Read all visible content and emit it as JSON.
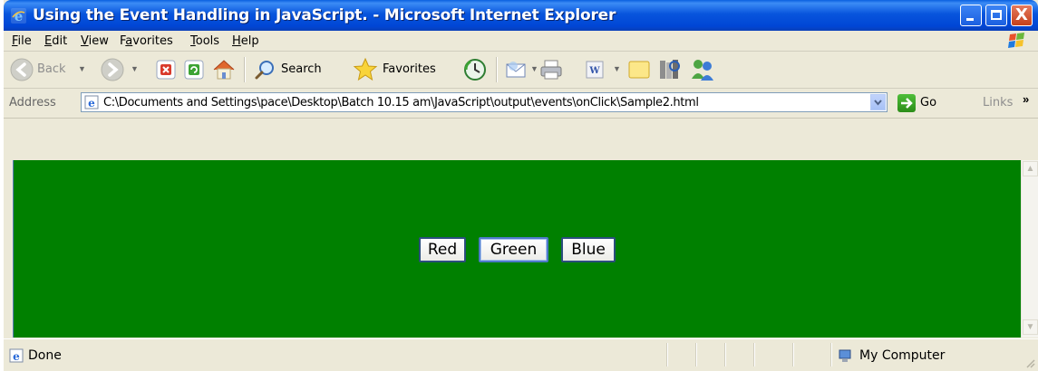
{
  "window": {
    "title": "Using the Event Handling in JavaScript. - Microsoft Internet Explorer",
    "controls": {
      "minimize": "minimize",
      "maximize": "maximize",
      "close": "X"
    }
  },
  "menu": {
    "items": [
      {
        "label": "File",
        "underline": "F"
      },
      {
        "label": "Edit",
        "underline": "E"
      },
      {
        "label": "View",
        "underline": "V"
      },
      {
        "label": "Favorites",
        "underline": "a"
      },
      {
        "label": "Tools",
        "underline": "T"
      },
      {
        "label": "Help",
        "underline": "H"
      }
    ]
  },
  "toolbar": {
    "back": "Back",
    "search": "Search",
    "favorites": "Favorites"
  },
  "address": {
    "label": "Address",
    "url": "C:\\Documents and Settings\\pace\\Desktop\\Batch 10.15 am\\JavaScript\\output\\events\\onClick\\Sample2.html",
    "go": "Go",
    "links": "Links",
    "links_more": "»"
  },
  "page": {
    "background": "#008000",
    "buttons": [
      {
        "label": "Red"
      },
      {
        "label": "Green"
      },
      {
        "label": "Blue"
      }
    ]
  },
  "status": {
    "text": "Done",
    "zone": "My Computer"
  },
  "colors": {
    "titlebar": "#0055E5",
    "page_background": "#008000",
    "chrome": "#ECE9D8"
  }
}
